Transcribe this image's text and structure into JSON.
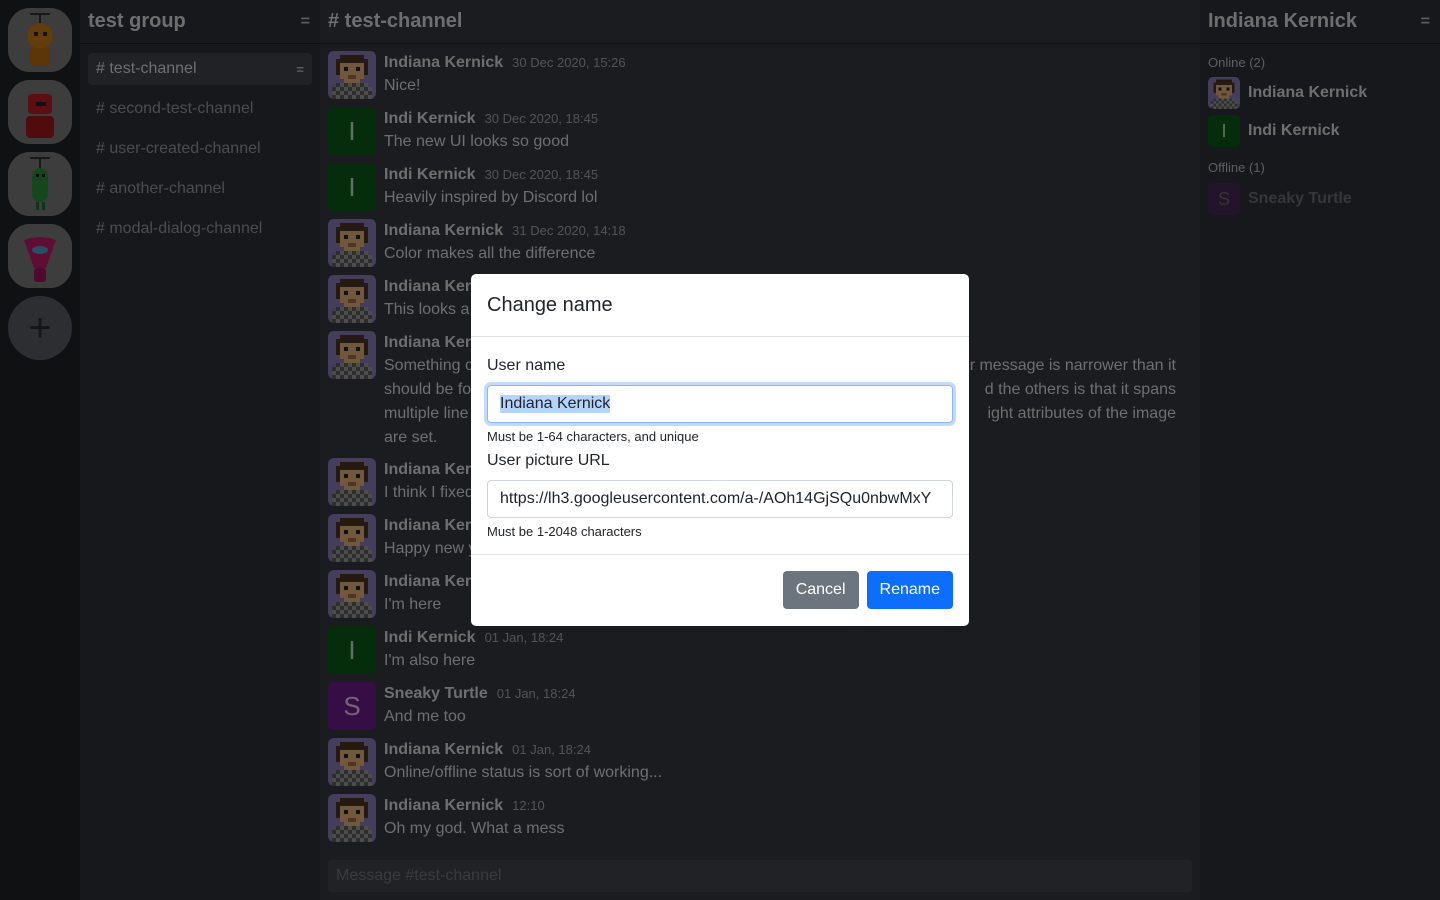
{
  "servers": [
    {
      "name": "server-orange-robot",
      "color": "#c77a19"
    },
    {
      "name": "server-red-robot",
      "color": "#b81e22"
    },
    {
      "name": "server-green-robot",
      "color": "#2a8f3a"
    },
    {
      "name": "server-pink-robot",
      "color": "#c2186b"
    }
  ],
  "add_server_label": "+",
  "group": {
    "title": "test group",
    "menu": "="
  },
  "channels": [
    {
      "label": "# test-channel",
      "active": true
    },
    {
      "label": "# second-test-channel"
    },
    {
      "label": "# user-created-channel"
    },
    {
      "label": "# another-channel"
    },
    {
      "label": "# modal-dialog-channel"
    }
  ],
  "chat": {
    "title": "# test-channel",
    "composer_placeholder": "Message #test-channel",
    "messages": [
      {
        "author": "Indiana Kernick",
        "time": "30 Dec 2020, 15:26",
        "text": "Nice!",
        "avatar": "pixel"
      },
      {
        "author": "Indi Kernick",
        "time": "30 Dec 2020, 18:45",
        "text": "The new UI looks so good",
        "avatar": "I"
      },
      {
        "author": "Indi Kernick",
        "time": "30 Dec 2020, 18:45",
        "text": "Heavily inspired by Discord lol",
        "avatar": "I"
      },
      {
        "author": "Indiana Kernick",
        "time": "31 Dec 2020, 14:18",
        "text": "Color makes all the difference",
        "avatar": "pixel"
      },
      {
        "author": "Indiana Kern",
        "time": "",
        "text": "This looks a",
        "avatar": "pixel"
      },
      {
        "author": "Indiana Kern",
        "time": "",
        "lines": [
          "Something o",
          "should be fo",
          "multiple line",
          "are set."
        ],
        "right_lines": [
          "r message is narrower than it",
          "d the others is that it spans",
          "ight attributes of the image",
          ""
        ],
        "avatar": "pixel"
      },
      {
        "author": "Indiana Kern",
        "time": "",
        "text": "I think I fixed",
        "avatar": "pixel"
      },
      {
        "author": "Indiana Kern",
        "time": "",
        "text": "Happy new y",
        "avatar": "pixel"
      },
      {
        "author": "Indiana Kern",
        "time": "",
        "text": "I'm here",
        "avatar": "pixel"
      },
      {
        "author": "Indi Kernick",
        "time": "01 Jan, 18:24",
        "text": "I'm also here",
        "avatar": "I"
      },
      {
        "author": "Sneaky Turtle",
        "time": "01 Jan, 18:24",
        "text": "And me too",
        "avatar": "S"
      },
      {
        "author": "Indiana Kernick",
        "time": "01 Jan, 18:24",
        "text": "Online/offline status is sort of working...",
        "avatar": "pixel"
      },
      {
        "author": "Indiana Kernick",
        "time": "12:10",
        "text": "Oh my god. What a mess",
        "avatar": "pixel"
      }
    ]
  },
  "members": {
    "title": "Indiana Kernick",
    "menu": "=",
    "online_label": "Online (2)",
    "offline_label": "Offline (1)",
    "online": [
      {
        "name": "Indiana Kernick",
        "avatar": "pixel"
      },
      {
        "name": "Indi Kernick",
        "avatar": "I"
      }
    ],
    "offline": [
      {
        "name": "Sneaky Turtle",
        "avatar": "S"
      }
    ]
  },
  "modal": {
    "title": "Change name",
    "username_label": "User name",
    "username_value": "Indiana Kernick",
    "username_help": "Must be 1-64 characters, and unique",
    "picture_label": "User picture URL",
    "picture_value": "https://lh3.googleusercontent.com/a-/AOh14GjSQu0nbwMxY",
    "picture_help": "Must be 1-2048 characters",
    "cancel_label": "Cancel",
    "rename_label": "Rename"
  }
}
